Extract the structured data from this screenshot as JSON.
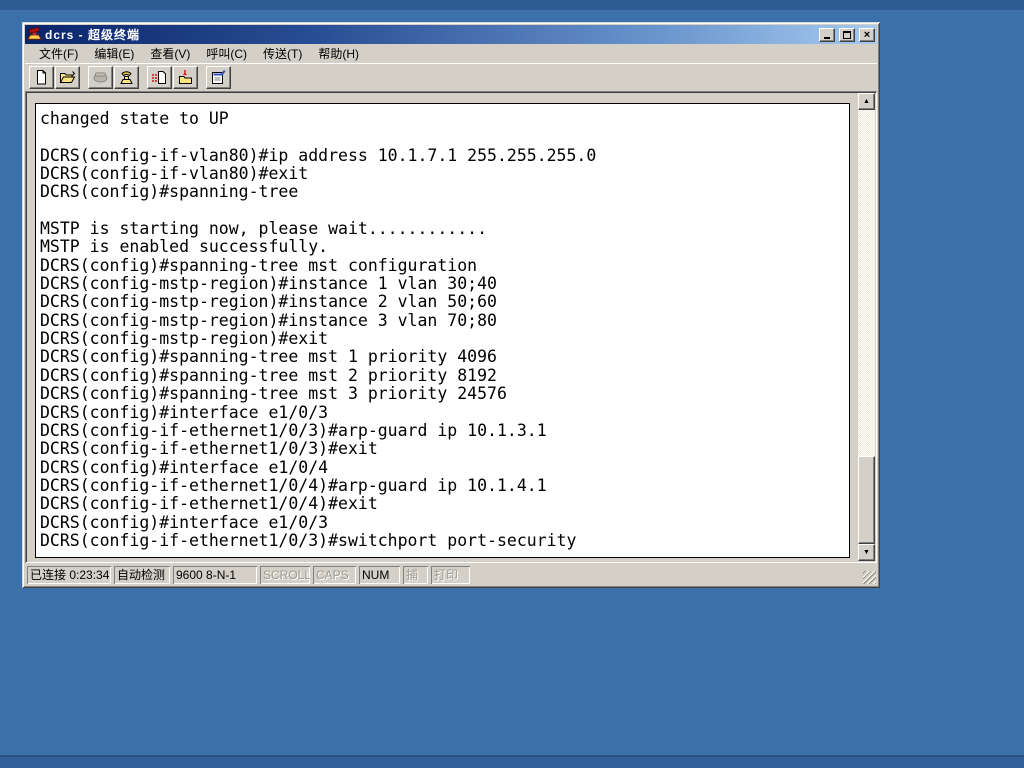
{
  "window": {
    "title": "dcrs - 超级终端",
    "app": "HyperTerminal",
    "controls": {
      "minimize": "minimize",
      "maximize": "maximize",
      "close": "close"
    }
  },
  "menu": {
    "items": [
      {
        "label": "文件(F)"
      },
      {
        "label": "编辑(E)"
      },
      {
        "label": "查看(V)"
      },
      {
        "label": "呼叫(C)"
      },
      {
        "label": "传送(T)"
      },
      {
        "label": "帮助(H)"
      }
    ]
  },
  "toolbar": {
    "buttons": [
      {
        "name": "new",
        "icon": "new-document-icon",
        "enabled": true
      },
      {
        "name": "open",
        "icon": "open-folder-icon",
        "enabled": true
      },
      {
        "name": "call",
        "icon": "call-phone-icon",
        "enabled": false
      },
      {
        "name": "disconnect",
        "icon": "disconnect-phone-icon",
        "enabled": true
      },
      {
        "name": "send",
        "icon": "send-file-icon",
        "enabled": true
      },
      {
        "name": "receive",
        "icon": "receive-file-icon",
        "enabled": true
      },
      {
        "name": "properties",
        "icon": "properties-icon",
        "enabled": true
      }
    ]
  },
  "terminal": {
    "lines": [
      "changed state to UP",
      "",
      "DCRS(config-if-vlan80)#ip address 10.1.7.1 255.255.255.0",
      "DCRS(config-if-vlan80)#exit",
      "DCRS(config)#spanning-tree",
      "",
      "MSTP is starting now, please wait............",
      "MSTP is enabled successfully.",
      "DCRS(config)#spanning-tree mst configuration",
      "DCRS(config-mstp-region)#instance 1 vlan 30;40",
      "DCRS(config-mstp-region)#instance 2 vlan 50;60",
      "DCRS(config-mstp-region)#instance 3 vlan 70;80",
      "DCRS(config-mstp-region)#exit",
      "DCRS(config)#spanning-tree mst 1 priority 4096",
      "DCRS(config)#spanning-tree mst 2 priority 8192",
      "DCRS(config)#spanning-tree mst 3 priority 24576",
      "DCRS(config)#interface e1/0/3",
      "DCRS(config-if-ethernet1/0/3)#arp-guard ip 10.1.3.1",
      "DCRS(config-if-ethernet1/0/3)#exit",
      "DCRS(config)#interface e1/0/4",
      "DCRS(config-if-ethernet1/0/4)#arp-guard ip 10.1.4.1",
      "DCRS(config-if-ethernet1/0/4)#exit",
      "DCRS(config)#interface e1/0/3",
      "DCRS(config-if-ethernet1/0/3)#switchport port-security"
    ]
  },
  "statusbar": {
    "panels": [
      {
        "label": "已连接 0:23:34",
        "state": "enabled"
      },
      {
        "label": "自动检测",
        "state": "enabled"
      },
      {
        "label": "9600 8-N-1",
        "state": "enabled"
      },
      {
        "label": "SCROLL",
        "state": "disabled"
      },
      {
        "label": "CAPS",
        "state": "disabled"
      },
      {
        "label": "NUM",
        "state": "enabled"
      },
      {
        "label": "捕",
        "state": "disabled"
      },
      {
        "label": "打印",
        "state": "disabled"
      }
    ]
  },
  "colors": {
    "desktop": "#3c70a8",
    "desktop_strip": "#2d5c92",
    "chrome": "#D4D0C8",
    "title_gradient_start": "#0A246A",
    "title_gradient_end": "#A6CAF0",
    "terminal_bg": "#ffffff",
    "terminal_fg": "#000000",
    "disabled_text": "#9d9a90"
  }
}
